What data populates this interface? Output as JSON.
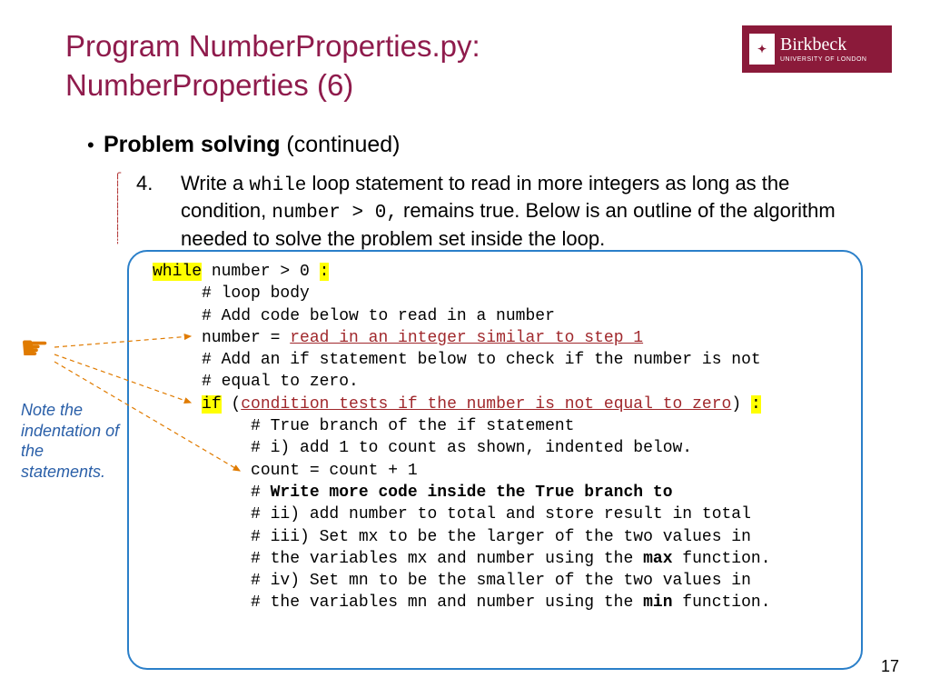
{
  "title_line1": "Program NumberProperties.py:",
  "title_line2": "NumberProperties ",
  "title_paren": "(6)",
  "logo": {
    "big": "Birkbeck",
    "small": "UNIVERSITY OF LONDON"
  },
  "bullet": {
    "bold": "Problem solving",
    "rest": " (continued)"
  },
  "step": {
    "num": "4.",
    "pre": "Write a ",
    "kw1": "while",
    "mid1": " loop statement to read in  more integers as long as the condition, ",
    "kw2": "number > 0,",
    "post": " remains true. Below is an outline of the algorithm needed to solve the problem set inside the loop."
  },
  "code": {
    "l1a": "while",
    "l1b": " number > 0 ",
    "l1c": ":",
    "l2": "     # loop body",
    "l3": "     # Add code below to read in a number",
    "l4a": "     number = ",
    "l4b": "read in an integer similar to step 1",
    "l5": "     # Add an if statement below to check if the number is not",
    "l6": "     # equal to zero.",
    "l7a": "     ",
    "l7b": "if",
    "l7c": " (",
    "l7d": "condition tests if the number is not equal to zero",
    "l7e": ") ",
    "l7f": ":",
    "l8": "          # True branch of the if statement",
    "l9": "          # i) add 1 to count as shown, indented below.",
    "l10": "          count = count + 1",
    "l11a": "          # ",
    "l11b": "Write more code inside the True branch to",
    "l12": "          # ii) add number to total and store result in total",
    "l13": "          # iii) Set mx to be the larger of the two values in",
    "l14a": "          # the variables mx and number using the ",
    "l14b": "max",
    "l14c": " function.",
    "l15": "          # iv) Set mn to be the smaller of the two values in",
    "l16a": "          # the variables mn and number using the ",
    "l16b": "min",
    "l16c": " function."
  },
  "note": "Note the indentation of the statements.",
  "pagenum": "17"
}
